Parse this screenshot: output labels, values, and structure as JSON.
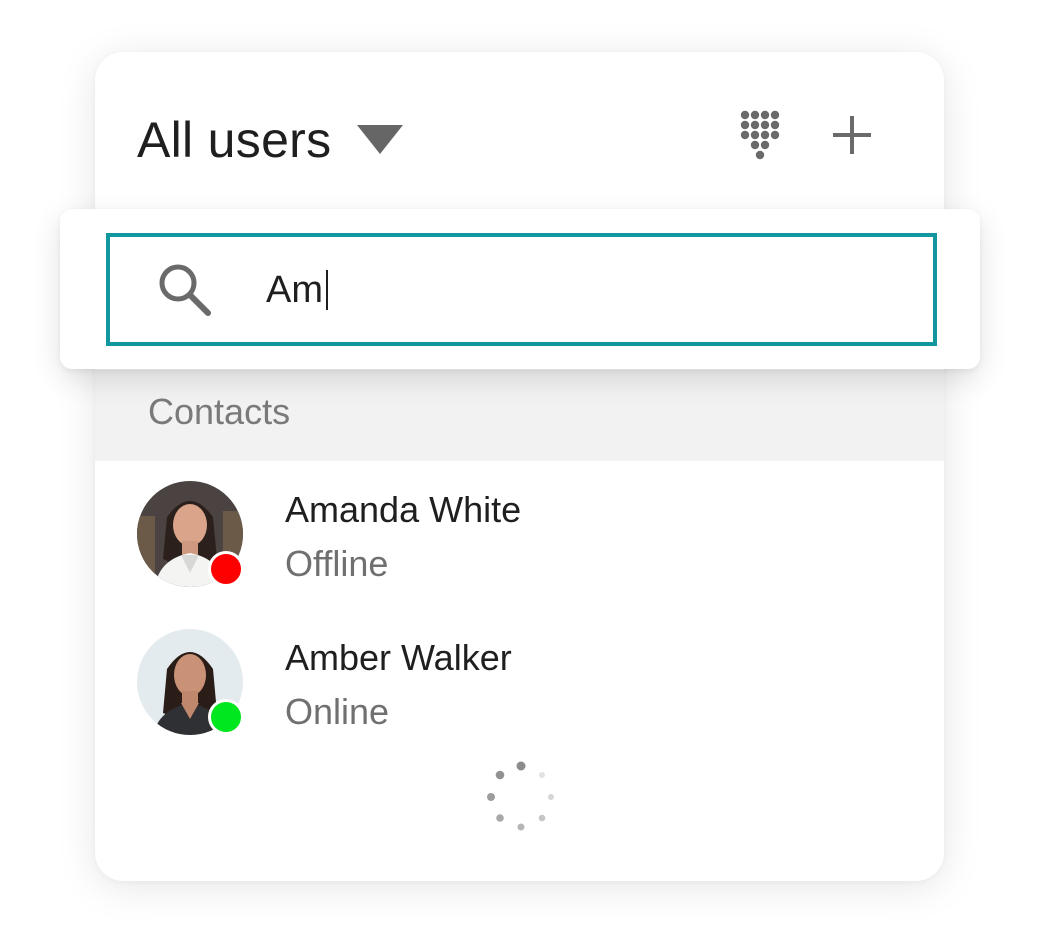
{
  "header": {
    "title": "All users",
    "dialpad_icon": "dialpad-icon",
    "add_icon": "plus-icon"
  },
  "search": {
    "value": "Am",
    "icon": "search-icon",
    "border_color": "#13979f"
  },
  "section": {
    "label": "Contacts"
  },
  "contacts": [
    {
      "name": "Amanda White",
      "status": "Offline",
      "status_color": "#ff0000"
    },
    {
      "name": "Amber Walker",
      "status": "Online",
      "status_color": "#00e61f"
    }
  ],
  "loading": {
    "icon": "loading-spinner-icon"
  }
}
